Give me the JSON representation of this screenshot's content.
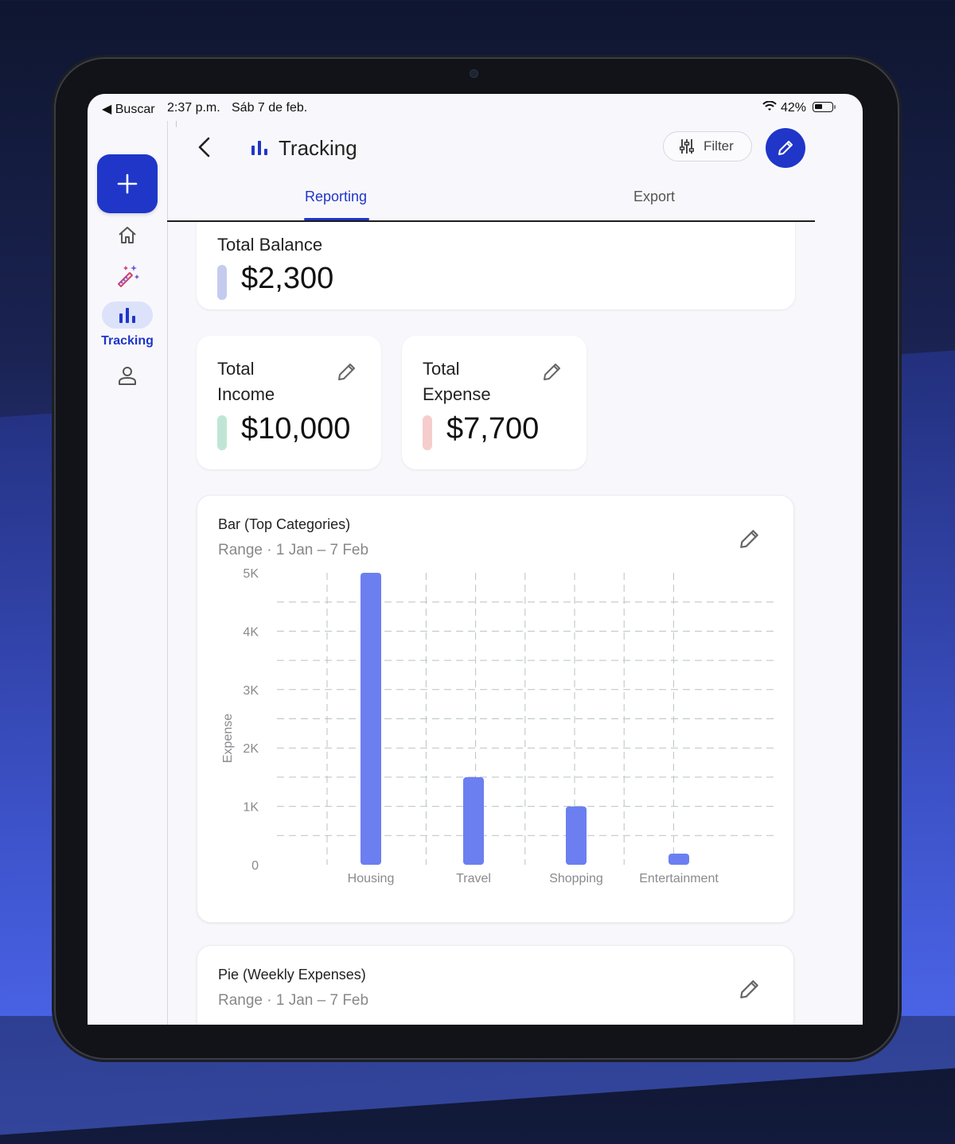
{
  "status_bar": {
    "back_label": "◀ Buscar",
    "time": "2:37 p.m.",
    "date": "Sáb 7 de feb.",
    "battery": "42%"
  },
  "rail": {
    "active_label": "Tracking"
  },
  "header": {
    "title": "Tracking",
    "filter_label": "Filter"
  },
  "tabs": [
    {
      "label": "Reporting",
      "active": true
    },
    {
      "label": "Export",
      "active": false
    }
  ],
  "balance": {
    "label": "Total Balance",
    "value": "$2,300",
    "color": "#c5cbef"
  },
  "income": {
    "label_line1": "Total",
    "label_line2": "Income",
    "value": "$10,000",
    "color": "#bfe6d4"
  },
  "expense": {
    "label_line1": "Total",
    "label_line2": "Expense",
    "value": "$7,700",
    "color": "#f6cdcd"
  },
  "bar_card": {
    "title": "Bar (Top Categories)",
    "range": "Range · 1 Jan – 7 Feb"
  },
  "pie_card": {
    "title": "Pie (Weekly Expenses)",
    "range": "Range · 1 Jan – 7 Feb"
  },
  "colors": {
    "accent": "#1f36c9",
    "bar": "#6b7ff0"
  },
  "chart_data": {
    "type": "bar",
    "categories": [
      "Housing",
      "Travel",
      "Shopping",
      "Entertainment"
    ],
    "values": [
      5000,
      1500,
      1000,
      100
    ],
    "ylabel": "Expense",
    "xlabel": "",
    "ylim": [
      0,
      5000
    ],
    "yticks": [
      "0",
      "1K",
      "2K",
      "3K",
      "4K",
      "5K"
    ],
    "grid": true
  }
}
